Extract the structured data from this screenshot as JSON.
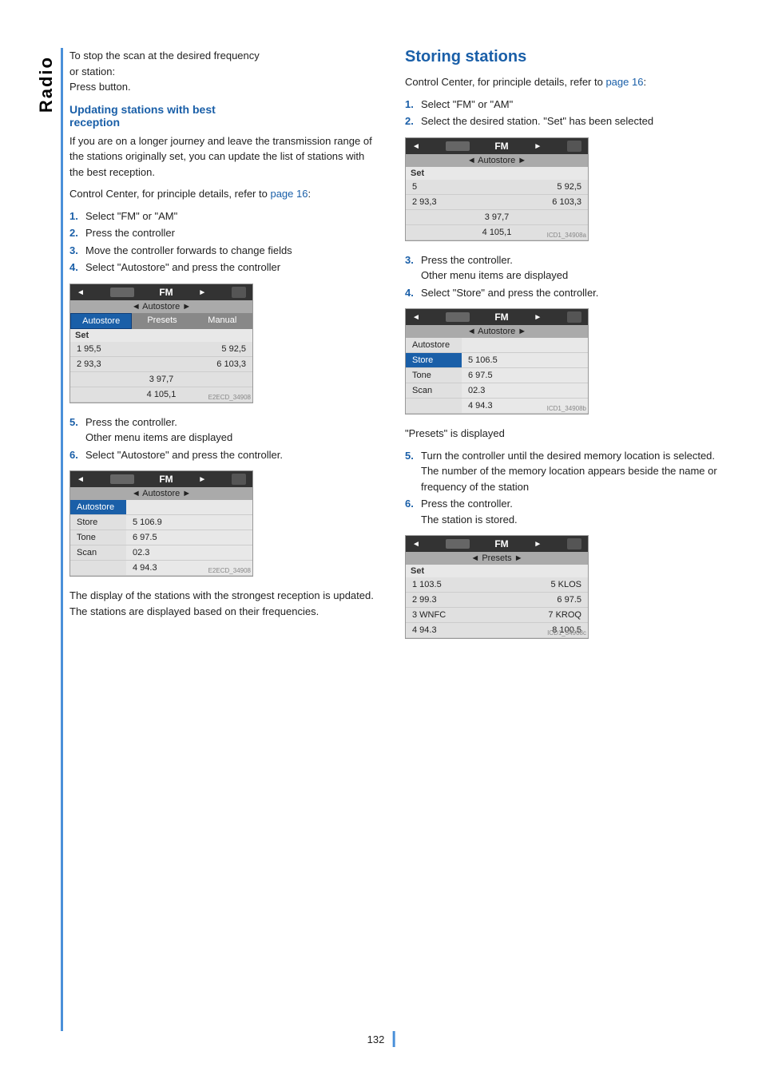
{
  "page": {
    "number": "132",
    "sidebar_label": "Radio"
  },
  "left_column": {
    "intro": {
      "line1": "To stop the scan at the desired frequency",
      "line2": "or station:",
      "line3": "Press button."
    },
    "section1": {
      "heading": "Updating stations with best",
      "heading2": "reception",
      "body1": "If you are on a longer journey and leave the transmission range of the stations originally set, you can update the list of stations with the best reception.",
      "body2": "Control Center, for principle details, refer to",
      "body2_link": "page 16",
      "body2_end": ":",
      "steps": [
        {
          "num": "1.",
          "text": "Select \"FM\" or \"AM\""
        },
        {
          "num": "2.",
          "text": "Press the controller"
        },
        {
          "num": "3.",
          "text": "Move the controller forwards to change fields"
        },
        {
          "num": "4.",
          "text": "Select \"Autostore\" and press the controller"
        }
      ],
      "step5": "5.",
      "step5_text": "Press the controller.",
      "step5b": "Other menu items are displayed",
      "step6": "6.",
      "step6_text": "Select \"Autostore\" and press the controller.",
      "bottom_text": "The display of the stations with the strongest reception is updated. The stations are displayed based on their frequencies."
    },
    "screen1": {
      "header_left": "◄",
      "header_fm": "FM",
      "header_right": "►",
      "sub": "◄ Autostore ►",
      "tabs": [
        "Autostore",
        "Presets",
        "Manual"
      ],
      "set_label": "Set",
      "cells": [
        {
          "left": "1 95,5",
          "right": "5 92,5"
        },
        {
          "left": "2 93,3",
          "right": "6 103,3"
        },
        {
          "center": "3 97,7"
        },
        {
          "center": "4 105,1"
        }
      ],
      "watermark": "E2ECD_34908"
    },
    "screen2": {
      "header_fm": "FM",
      "sub": "◄ Autostore ►",
      "menu": [
        {
          "label": "Autostore",
          "highlighted": true
        },
        {
          "label": "Store",
          "value": "5 106.9"
        },
        {
          "label": "Tone",
          "value": "6 97.5"
        },
        {
          "label": "Scan",
          "value": "02.3"
        },
        {
          "label": "",
          "value": "4 94.3",
          "full": true
        }
      ],
      "watermark": "E2ECD_34908"
    }
  },
  "right_column": {
    "section2": {
      "heading": "Storing stations",
      "body1": "Control Center, for principle details, refer to page 16:",
      "body1_link": "page 16",
      "steps": [
        {
          "num": "1.",
          "text": "Select \"FM\" or \"AM\""
        },
        {
          "num": "2.",
          "text": "Select the desired station. \"Set\" has been selected"
        }
      ],
      "step3": "3.",
      "step3_text": "Press the controller.",
      "step3b": "Other menu items are displayed",
      "step4": "4.",
      "step4_text": "Select \"Store\" and press the controller.",
      "presets_label": "\"Presets\" is displayed",
      "step5": "5.",
      "step5_text_lines": [
        "Turn the controller until the desired memory location is selected.",
        "The number of the memory location appears beside the name or frequency of the station"
      ],
      "step6": "6.",
      "step6_text": "Press the controller.",
      "step6b": "The station is stored."
    },
    "screen1": {
      "header_fm": "FM",
      "sub": "◄ Autostore ►",
      "set_label": "Set",
      "cells": [
        {
          "left": "5",
          "right": "5 92,5"
        },
        {
          "left": "2 93,3",
          "right": "6 103,3"
        },
        {
          "center": "3 97,7"
        },
        {
          "center": "4 105,1"
        }
      ],
      "watermark": "ICD1_34908a"
    },
    "screen2": {
      "header_fm": "FM",
      "sub": "◄ Autostore ►",
      "menu": [
        {
          "label": "Autostore"
        },
        {
          "label": "Store",
          "highlighted": true,
          "value": "5 106.5"
        },
        {
          "label": "Tone",
          "value": "6 97.5"
        },
        {
          "label": "Scan",
          "value": "02.3"
        },
        {
          "label": "",
          "value": "4 94.3",
          "full": true
        }
      ],
      "watermark": "ICD1_34908b"
    },
    "screen3": {
      "header_fm": "FM",
      "sub": "◄ Presets ►",
      "set_label": "Set",
      "cells": [
        {
          "left": "1 103.5",
          "right": "5 KLOS"
        },
        {
          "left": "2 99.3",
          "right": "6 97.5"
        },
        {
          "left": "3 WNFC",
          "right": "7 KROQ"
        },
        {
          "left": "4 94.3",
          "right": "8 100.5"
        }
      ],
      "watermark": "ICD1_34908c"
    }
  }
}
